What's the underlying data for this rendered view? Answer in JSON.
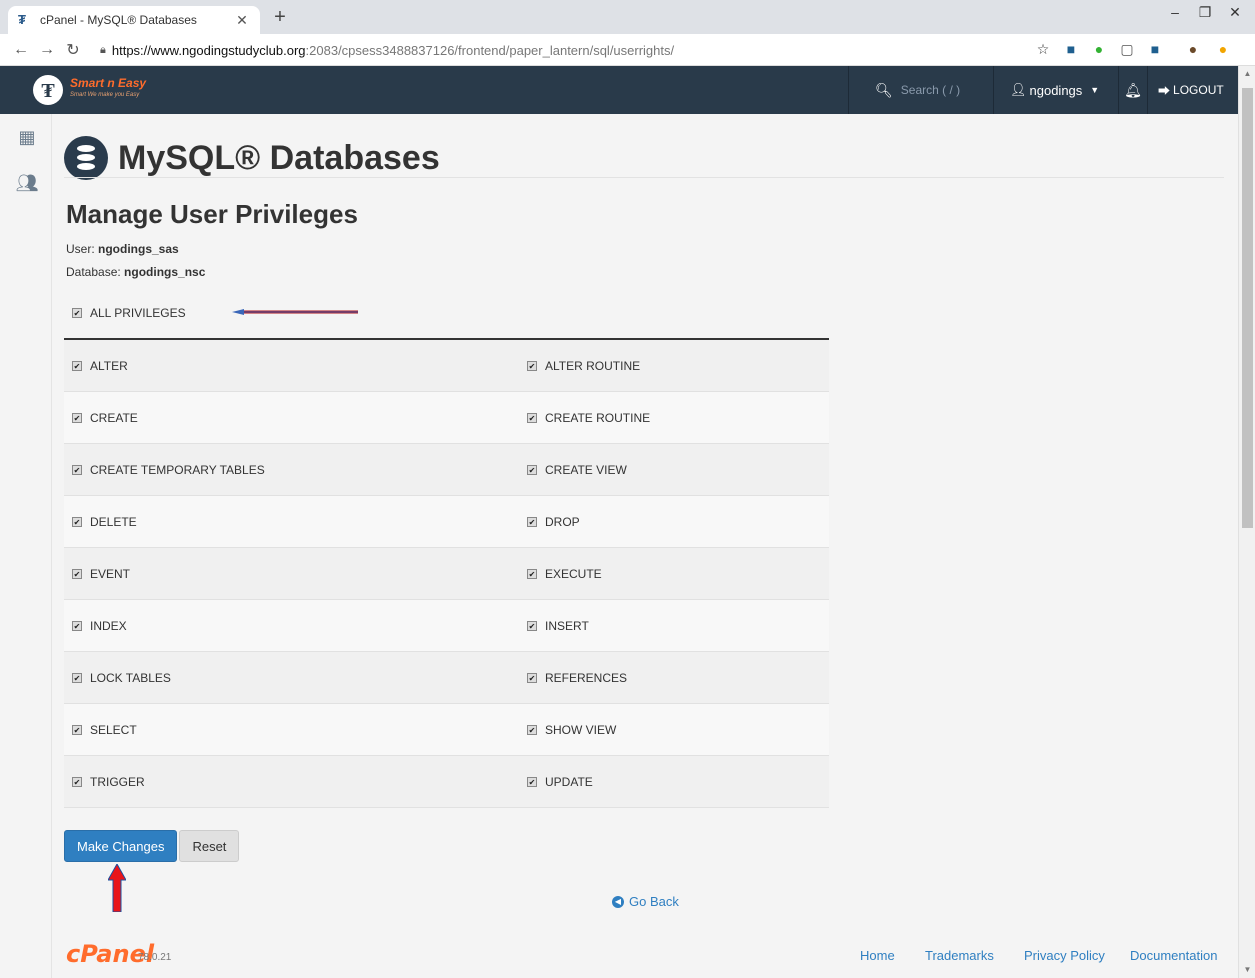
{
  "browser": {
    "tab_title": "cPanel - MySQL® Databases",
    "url_host": "https://www.ngodingstudyclub.org",
    "url_path": ":2083/cpsess3488837126/frontend/paper_lantern/sql/userrights/"
  },
  "topnav": {
    "brand": "Smart n Easy",
    "brand_tagline": "Smart We make you Easy",
    "search_placeholder": "Search ( / )",
    "user": "ngodings",
    "logout": "LOGOUT"
  },
  "page": {
    "title": "MySQL® Databases",
    "section_title": "Manage User Privileges",
    "user_label": "User:",
    "user_value": "ngodings_sas",
    "db_label": "Database:",
    "db_value": "ngodings_nsc",
    "all_privileges": "ALL PRIVILEGES"
  },
  "privileges": [
    [
      "ALTER",
      "ALTER ROUTINE"
    ],
    [
      "CREATE",
      "CREATE ROUTINE"
    ],
    [
      "CREATE TEMPORARY TABLES",
      "CREATE VIEW"
    ],
    [
      "DELETE",
      "DROP"
    ],
    [
      "EVENT",
      "EXECUTE"
    ],
    [
      "INDEX",
      "INSERT"
    ],
    [
      "LOCK TABLES",
      "REFERENCES"
    ],
    [
      "SELECT",
      "SHOW VIEW"
    ],
    [
      "TRIGGER",
      "UPDATE"
    ]
  ],
  "buttons": {
    "make_changes": "Make Changes",
    "reset": "Reset",
    "go_back": "Go Back"
  },
  "footer": {
    "logo": "cPanel",
    "version": "78.0.21",
    "links": [
      "Home",
      "Trademarks",
      "Privacy Policy",
      "Documentation"
    ]
  },
  "colors": {
    "navbar": "#293a4a",
    "brand_orange": "#ff6c2c",
    "primary_button": "#2f7fc1",
    "annotation_arrow": "#e8141a"
  }
}
